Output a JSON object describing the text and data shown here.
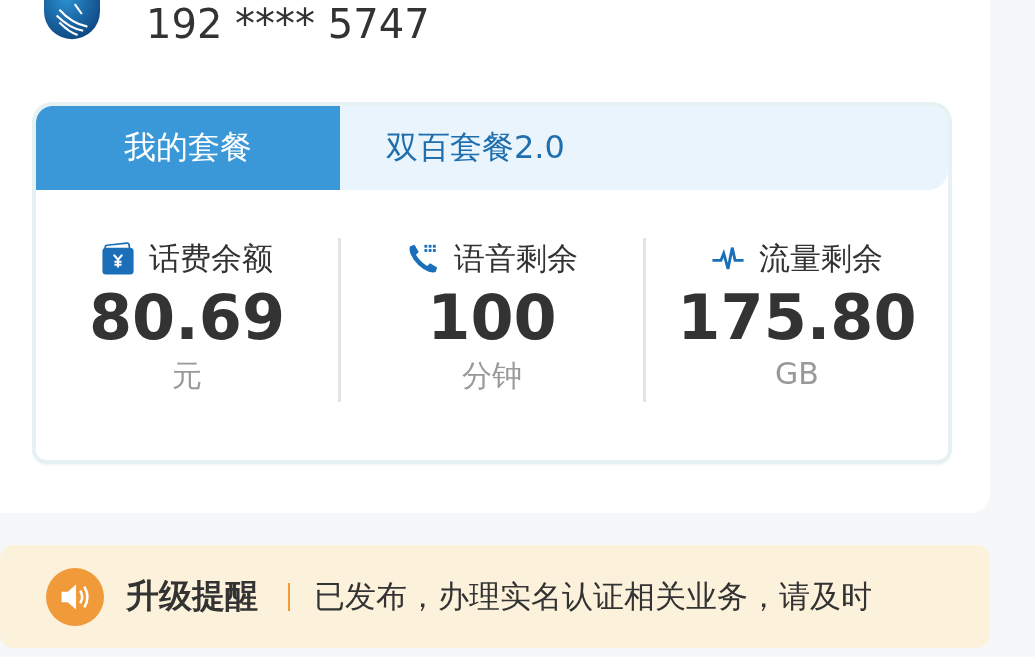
{
  "account": {
    "phone": "192 **** 5747"
  },
  "plan_tabs": [
    {
      "label": "我的套餐",
      "selected": true
    },
    {
      "label": "双百套餐2.0",
      "selected": false
    }
  ],
  "stats": [
    {
      "kind": "balance",
      "label": "话费余额",
      "value": "80.69",
      "unit": "元"
    },
    {
      "kind": "voice",
      "label": "语音剩余",
      "value": "100",
      "unit": "分钟"
    },
    {
      "kind": "data",
      "label": "流量剩余",
      "value": "175.80",
      "unit": "GB"
    }
  ],
  "notice": {
    "title": "升级提醒",
    "text": "已发布，办理实名认证相关业务，请及时"
  }
}
